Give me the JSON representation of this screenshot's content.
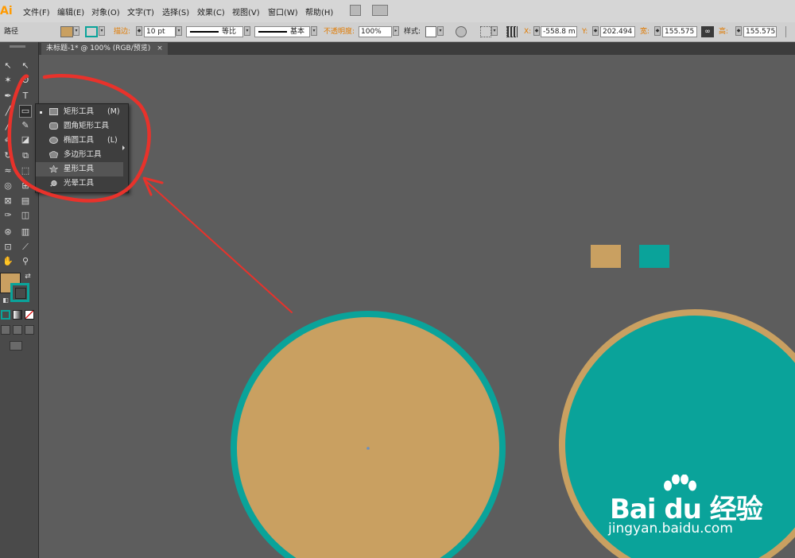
{
  "app": {
    "logo": "Ai",
    "accent_color": "#ff9a00"
  },
  "menubar": {
    "items": [
      "文件(F)",
      "编辑(E)",
      "对象(O)",
      "文字(T)",
      "选择(S)",
      "效果(C)",
      "视图(V)",
      "窗口(W)",
      "帮助(H)"
    ]
  },
  "control_bar": {
    "object_type": "路径",
    "fill_color": "#c9a061",
    "stroke_color": "#0aa39a",
    "stroke_label": "描边:",
    "stroke_weight": "10 pt",
    "profile_label": "等比",
    "brush_label": "基本",
    "opacity_label": "不透明度:",
    "opacity_value": "100%",
    "style_label": "样式:",
    "x_label": "X:",
    "x_value": "-558.8 m",
    "y_label": "Y:",
    "y_value": "202.494",
    "w_label": "宽:",
    "w_value": "155.575",
    "h_label": "高:",
    "h_value": "155.575"
  },
  "document_tab": {
    "title": "未标题-1* @ 100% (RGB/预览)",
    "close": "×"
  },
  "flyout": {
    "items": [
      {
        "label": "矩形工具",
        "shortcut": "(M)",
        "icon": "rectangle-icon"
      },
      {
        "label": "圆角矩形工具",
        "shortcut": "",
        "icon": "rounded-rectangle-icon"
      },
      {
        "label": "椭圆工具",
        "shortcut": "(L)",
        "icon": "ellipse-icon"
      },
      {
        "label": "多边形工具",
        "shortcut": "",
        "icon": "polygon-icon"
      },
      {
        "label": "星形工具",
        "shortcut": "",
        "icon": "star-icon"
      },
      {
        "label": "光晕工具",
        "shortcut": "",
        "icon": "flare-icon"
      }
    ]
  },
  "canvas": {
    "swatch_fill": "#c9a061",
    "swatch_teal": "#0aa39a",
    "annotation_color": "#e8322b"
  },
  "watermark": {
    "brand": "Bai du 经验",
    "url": "jingyan.baidu.com"
  }
}
